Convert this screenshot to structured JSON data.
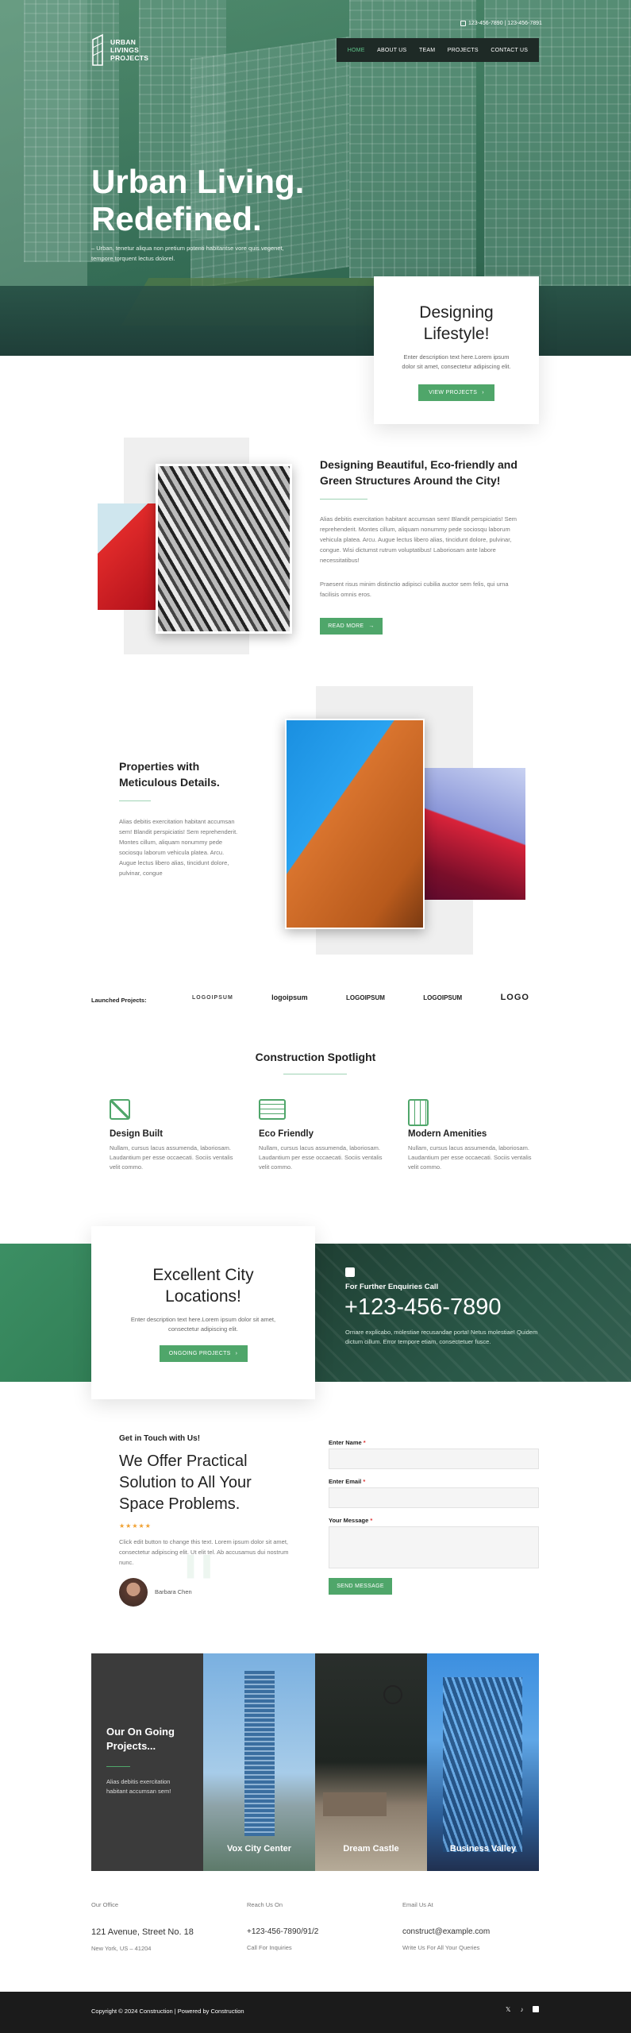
{
  "header": {
    "logo_lines": [
      "URBAN",
      "LIVINGS",
      "PROJECTS"
    ],
    "phone": "123-456-7890 | 123-456-7891",
    "nav": [
      "HOME",
      "ABOUT US",
      "TEAM",
      "PROJECTS",
      "CONTACT US"
    ]
  },
  "hero": {
    "title_line1": "Urban Living.",
    "title_line2": "Redefined.",
    "subtitle": "– Urban, tenetur aliqua non pretium potenti habitantse vore quis vegenet, tempore torquent lectus dolorel."
  },
  "design_card": {
    "title": "Designing Lifestyle!",
    "text": "Enter description text here.Lorem ipsum dolor sit amet, consectetur adipiscing elit.",
    "button": "VIEW PROJECTS"
  },
  "about": {
    "title": "Designing Beautiful, Eco-friendly and Green Structures Around the City!",
    "p1": "Alias debitis exercitation habitant accumsan sem! Blandit perspiciatis! Sem reprehenderit. Montes cillum, aliquam nonummy pede sociosqu laborum vehicula platea. Arcu. Augue lectus libero alias, tincidunt dolore, pulvinar, congue. Wisi dictumst rutrum voluptatibus! Laboriosam ante labore necessitatibus!",
    "p2": "Praesent risus minim distinctio adipisci cubilia auctor sem felis, qui urna facilisis omnis eros.",
    "button": "READ MORE"
  },
  "properties": {
    "title": "Properties with Meticulous Details.",
    "text": "Alias debitis exercitation habitant accumsan sem! Blandit perspiciatis! Sem reprehenderit. Montes cillum, aliquam nonummy pede sociosqu laborum vehicula platea. Arcu. Augue lectus libero alias, tincidunt dolore, pulvinar, congue"
  },
  "launched": {
    "label": "Launched Projects:",
    "logos": [
      "LOGOIPSUM",
      "logoipsum",
      "LOGOIPSUM",
      "LOGOIPSUM",
      "LOGO"
    ]
  },
  "spotlight": {
    "title": "Construction Spotlight",
    "features": [
      {
        "icon": "ruler-pencil-icon",
        "title": "Design Built",
        "text": "Nullam, cursus lacus assumenda, laboriosam. Laudantium per esse occaecati. Sociis ventalis velit commo."
      },
      {
        "icon": "blueprint-icon",
        "title": "Eco Friendly",
        "text": "Nullam, cursus lacus assumenda, laboriosam. Laudantium per esse occaecati. Sociis ventalis velit commo."
      },
      {
        "icon": "building-plan-icon",
        "title": "Modern Amenities",
        "text": "Nullam, cursus lacus assumenda, laboriosam. Laudantium per esse occaecati. Sociis ventalis velit commo."
      }
    ]
  },
  "city_card": {
    "title": "Excellent City Locations!",
    "text": "Enter description text here.Lorem ipsum dolor sit amet, consectetur adipiscing elit.",
    "button": "ONGOING PROJECTS"
  },
  "enquiries": {
    "label": "For Further Enquiries Call",
    "phone": "+123-456-7890",
    "text": "Ornare explicabo, molestiae recusandae porta! Netus molestiae! Quidem dictum cillum. Error tempore etiam, consectetuer fusce."
  },
  "contact": {
    "kicker": "Get in Touch with Us!",
    "title": "We Offer Practical Solution to All Your Space Problems.",
    "stars": "★★★★★",
    "text": "Click edit button to change this text. Lorem ipsum dolor sit amet, consectetur adipiscing elit. Ut elit tel. Ab accusamus dui nostrum nunc.",
    "author": "Barbara Chen",
    "form": {
      "name_label": "Enter Name",
      "email_label": "Enter Email",
      "message_label": "Your Message",
      "required": "*",
      "submit": "SEND MESSAGE"
    }
  },
  "projects": {
    "title": "Our On Going Projects...",
    "text": "Alias debitis exercitation habitant accumsan sem!",
    "items": [
      "Vox City Center",
      "Dream Castle",
      "Business Valley"
    ]
  },
  "footer": {
    "office_label": "Our Office",
    "office_line1": "121 Avenue, Street No. 18",
    "office_line2": "New York, US – 41204",
    "reach_label": "Reach Us On",
    "reach_line1": "+123-456-7890/91/2",
    "reach_line2": "Call For Inquiries",
    "email_label": "Email Us At",
    "email_line1": "construct@example.com",
    "email_line2": "Write Us For All Your Queries",
    "copyright": "Copyright © 2024 Construction | Powered by Construction"
  },
  "colors": {
    "accent": "#4fa66a",
    "dark": "#1b1b1b",
    "hero_overlay": "#3c8c64"
  }
}
